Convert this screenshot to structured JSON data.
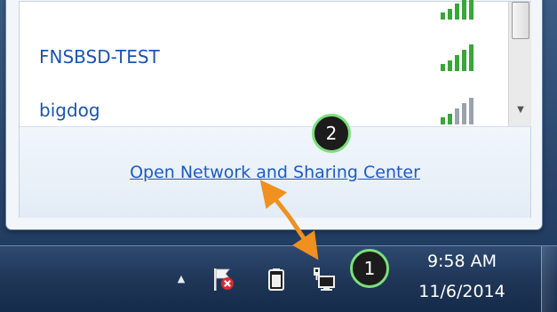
{
  "flyout": {
    "networks": [
      {
        "name": ""
      },
      {
        "name": "FNSBSD-TEST"
      },
      {
        "name": "bigdog"
      }
    ],
    "footer_link": "Open Network and Sharing Center"
  },
  "taskbar": {
    "show_hidden_icons": "▲",
    "clock": {
      "time": "9:58 AM",
      "date": "11/6/2014"
    }
  },
  "annotations": {
    "step1": "1",
    "step2": "2",
    "color": "#7be07b",
    "arrow_color": "#f0901e"
  },
  "colors": {
    "link": "#1c5bc6",
    "signal": "#3aa53a"
  }
}
